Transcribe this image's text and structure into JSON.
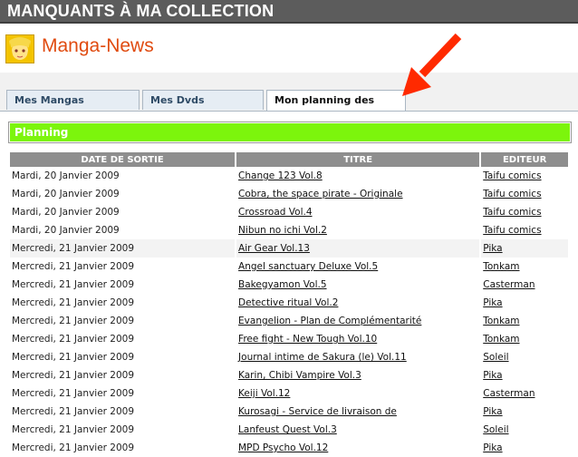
{
  "page": {
    "section_header": "MANQUANTS À MA COLLECTION"
  },
  "site": {
    "brand": "Manga-News"
  },
  "tabs": [
    {
      "label": "Mes Mangas Manquants",
      "active": false
    },
    {
      "label": "Mes Dvds Manquants",
      "active": false
    },
    {
      "label": "Mon planning des sorties",
      "active": true
    }
  ],
  "planning": {
    "title": "Planning",
    "columns": [
      "DATE DE SORTIE",
      "TITRE",
      "EDITEUR"
    ],
    "rows": [
      {
        "date": "Mardi, 20 Janvier 2009",
        "title": "Change 123 Vol.8",
        "editor": "Taifu comics"
      },
      {
        "date": "Mardi, 20 Janvier 2009",
        "title": "Cobra, the space pirate - Originale",
        "editor": "Taifu comics"
      },
      {
        "date": "Mardi, 20 Janvier 2009",
        "title": "Crossroad Vol.4",
        "editor": "Taifu comics"
      },
      {
        "date": "Mardi, 20 Janvier 2009",
        "title": "Nibun no ichi Vol.2",
        "editor": "Taifu comics"
      },
      {
        "date": "Mercredi, 21 Janvier 2009",
        "title": "Air Gear Vol.13",
        "editor": "Pika"
      },
      {
        "date": "Mercredi, 21 Janvier 2009",
        "title": "Angel sanctuary Deluxe Vol.5",
        "editor": "Tonkam"
      },
      {
        "date": "Mercredi, 21 Janvier 2009",
        "title": "Bakegyamon Vol.5",
        "editor": "Casterman"
      },
      {
        "date": "Mercredi, 21 Janvier 2009",
        "title": "Detective ritual Vol.2",
        "editor": "Pika"
      },
      {
        "date": "Mercredi, 21 Janvier 2009",
        "title": "Evangelion - Plan de Complémentarité",
        "editor": "Tonkam"
      },
      {
        "date": "Mercredi, 21 Janvier 2009",
        "title": "Free fight - New Tough Vol.10",
        "editor": "Tonkam"
      },
      {
        "date": "Mercredi, 21 Janvier 2009",
        "title": "Journal intime de Sakura (le) Vol.11",
        "editor": "Soleil"
      },
      {
        "date": "Mercredi, 21 Janvier 2009",
        "title": "Karin, Chibi Vampire Vol.3",
        "editor": "Pika"
      },
      {
        "date": "Mercredi, 21 Janvier 2009",
        "title": "Keiji Vol.12",
        "editor": "Casterman"
      },
      {
        "date": "Mercredi, 21 Janvier 2009",
        "title": "Kurosagi - Service de livraison de",
        "editor": "Pika"
      },
      {
        "date": "Mercredi, 21 Janvier 2009",
        "title": "Lanfeust Quest Vol.3",
        "editor": "Soleil"
      },
      {
        "date": "Mercredi, 21 Janvier 2009",
        "title": "MPD Psycho Vol.12",
        "editor": "Pika"
      }
    ]
  },
  "colors": {
    "header_bar": "#5c5c5c",
    "brand": "#e04b10",
    "section_green": "#7cf50c",
    "arrow": "#ff2a00"
  },
  "icons": {
    "logo": "manga-character-logo-icon",
    "annotation": "red-arrow-icon"
  }
}
